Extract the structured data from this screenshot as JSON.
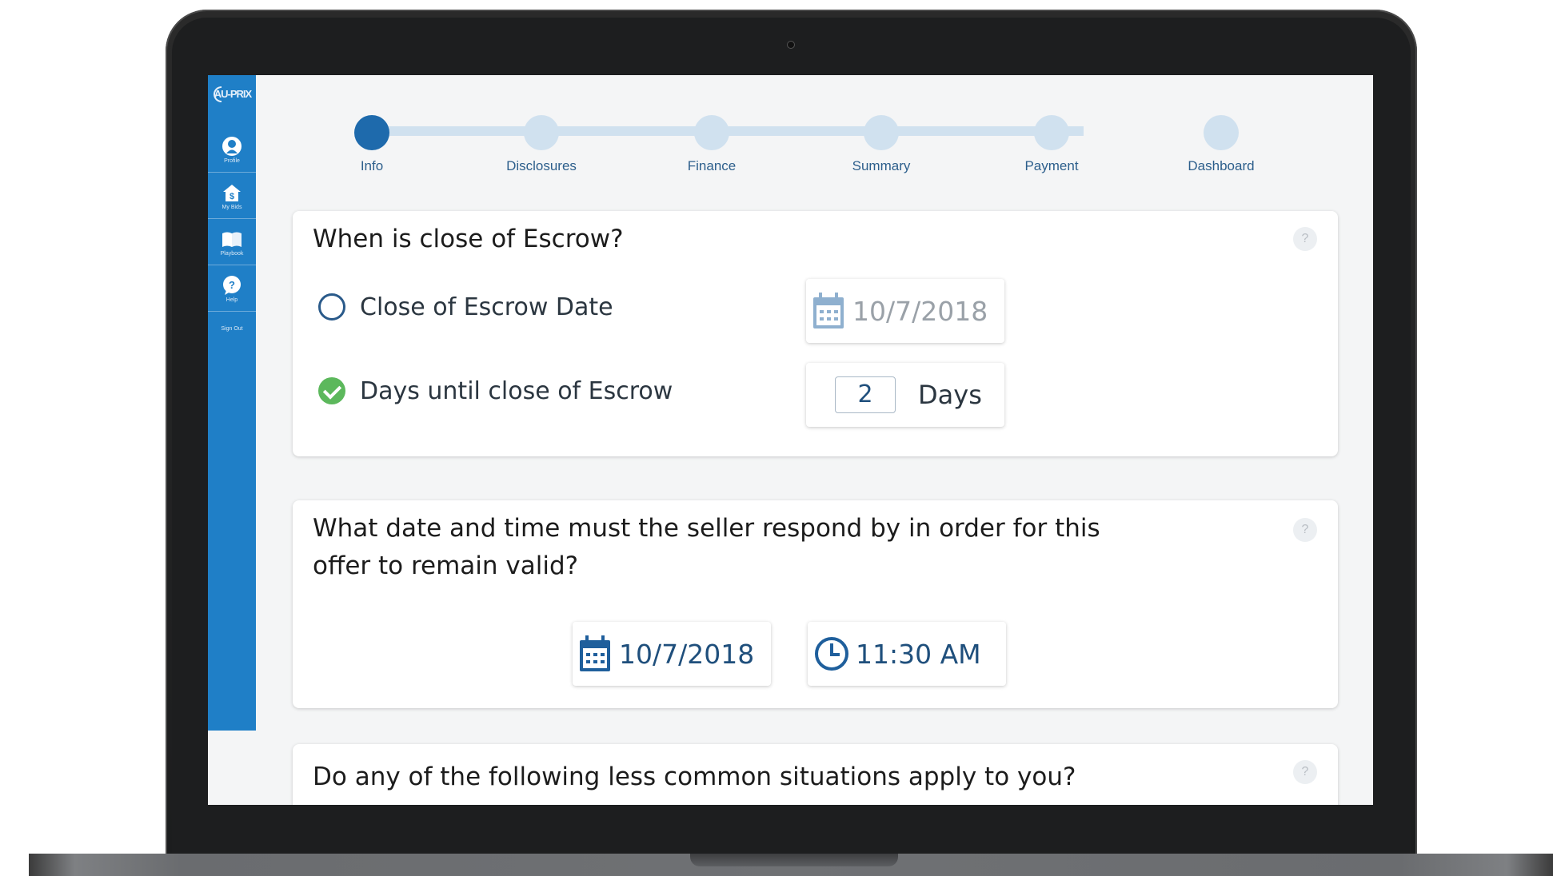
{
  "sidebar": {
    "logo": "AU-PRIX",
    "items": [
      {
        "label": "Profile",
        "icon": "profile-icon"
      },
      {
        "label": "My Bids",
        "icon": "house-dollar-icon"
      },
      {
        "label": "Playbook",
        "icon": "book-icon"
      },
      {
        "label": "Help",
        "icon": "help-bubble-icon"
      }
    ],
    "signout": "Sign Out",
    "color": "#1f7fc7"
  },
  "stepper": {
    "active_color": "#1e6aac",
    "inactive_color": "#d0e1ef",
    "steps": [
      {
        "label": "Info",
        "active": true
      },
      {
        "label": "Disclosures",
        "active": false
      },
      {
        "label": "Finance",
        "active": false
      },
      {
        "label": "Summary",
        "active": false
      },
      {
        "label": "Payment",
        "active": false
      },
      {
        "label": "Dashboard",
        "active": false
      }
    ]
  },
  "escrow_card": {
    "title": "When is close of Escrow?",
    "help": "?",
    "option_date_label": "Close of Escrow Date",
    "option_date_selected": false,
    "date_value": "10/7/2018",
    "option_days_label": "Days until close of Escrow",
    "option_days_selected": true,
    "days_value": "2",
    "days_unit": "Days"
  },
  "response_card": {
    "title_line1": "What date and time must the seller respond by in order for this",
    "title_line2": "offer to remain valid?",
    "help": "?",
    "date_value": "10/7/2018",
    "time_value": "11:30 AM"
  },
  "situations_card": {
    "title": "Do any of the following less common situations apply to you?",
    "help": "?"
  }
}
